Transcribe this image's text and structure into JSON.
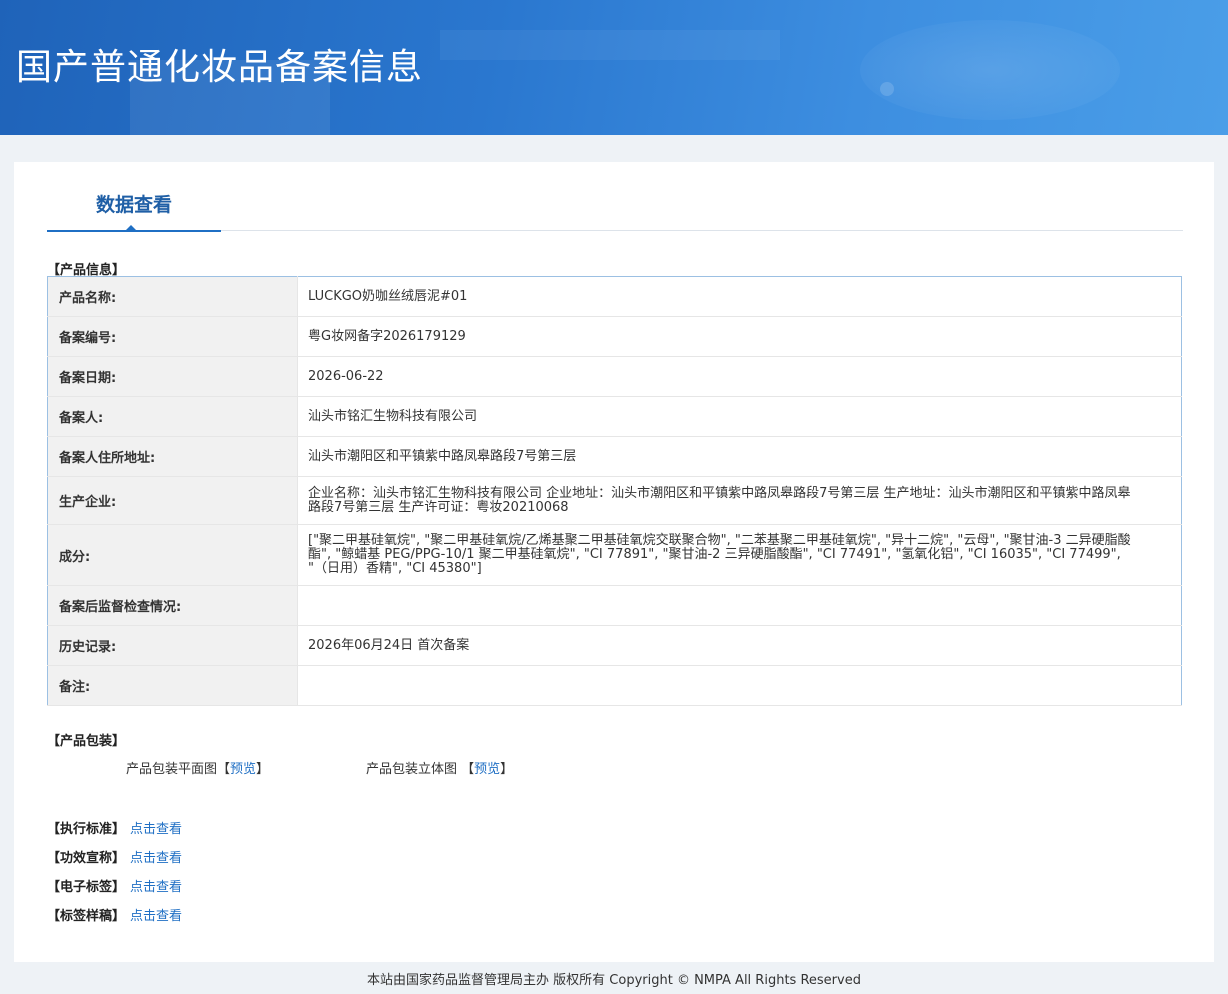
{
  "header": {
    "title": "国产普通化妆品备案信息"
  },
  "tab": {
    "label": "数据查看"
  },
  "product_info": {
    "section_label": "【产品信息】",
    "rows": [
      {
        "key": "产品名称:",
        "value": "LUCKGO奶咖丝绒唇泥#01"
      },
      {
        "key": "备案编号:",
        "value": "粤G妆网备字2026179129"
      },
      {
        "key": "备案日期:",
        "value": "2026-06-22"
      },
      {
        "key": "备案人:",
        "value": "汕头市铭汇生物科技有限公司"
      },
      {
        "key": "备案人住所地址:",
        "value": "汕头市潮阳区和平镇紫中路凤皋路段7号第三层"
      },
      {
        "key": "生产企业:",
        "value": "企业名称：汕头市铭汇生物科技有限公司 企业地址：汕头市潮阳区和平镇紫中路凤皋路段7号第三层 生产地址：汕头市潮阳区和平镇紫中路凤皋路段7号第三层 生产许可证：粤妆20210068"
      },
      {
        "key": "成分:",
        "value": "[\"聚二甲基硅氧烷\", \"聚二甲基硅氧烷/乙烯基聚二甲基硅氧烷交联聚合物\", \"二苯基聚二甲基硅氧烷\", \"异十二烷\", \"云母\", \"聚甘油-3 二异硬脂酸酯\", \"鲸蜡基 PEG/PPG-10/1 聚二甲基硅氧烷\", \"CI 77891\", \"聚甘油-2 三异硬脂酸酯\", \"CI 77491\", \"氢氧化铝\", \"CI 16035\", \"CI 77499\", \"（日用）香精\", \"CI 45380\"]"
      },
      {
        "key": "备案后监督检查情况:",
        "value": ""
      },
      {
        "key": "历史记录:",
        "value": "2026年06月24日 首次备案"
      },
      {
        "key": "备注:",
        "value": ""
      }
    ]
  },
  "packaging": {
    "section_label": "【产品包装】",
    "flat": {
      "label": "产品包装平面图",
      "open": "【",
      "link": "预览",
      "close": "】"
    },
    "solid": {
      "label": "产品包装立体图 ",
      "open": "【",
      "link": "预览",
      "close": "】"
    }
  },
  "links": [
    {
      "label": "【执行标准】",
      "link": "点击查看"
    },
    {
      "label": "【功效宣称】",
      "link": "点击查看"
    },
    {
      "label": "【电子标签】",
      "link": "点击查看"
    },
    {
      "label": "【标签样稿】",
      "link": "点击查看"
    }
  ],
  "footer": {
    "text": "本站由国家药品监督管理局主办 版权所有 Copyright © NMPA All Rights Reserved"
  },
  "colors": {
    "header": "#2a77cf",
    "accent": "#1f6fc4",
    "key_bg": "#f1f1f1"
  }
}
